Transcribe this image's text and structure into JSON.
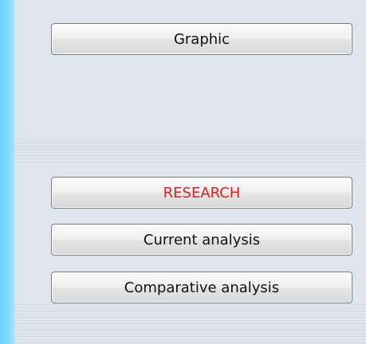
{
  "buttons": {
    "graphic": "Graphic",
    "research": "RESEARCH",
    "current_analysis": "Current analysis",
    "comparative_analysis": "Comparative analysis"
  },
  "colors": {
    "panel_bg": "#dde5ee",
    "accent_stripe": "#7fd8fb",
    "research_text": "#e01e1e"
  }
}
